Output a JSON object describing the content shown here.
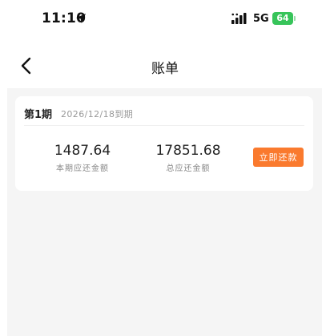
{
  "status_bar": {
    "time": "11:10",
    "network": "5G",
    "battery_level": "64"
  },
  "nav": {
    "title": "账单"
  },
  "bill": {
    "period": "第1期",
    "due_date": "2026/12/18到期",
    "current_amount": "1487.64",
    "current_amount_label": "本期应还金额",
    "total_amount": "17851.68",
    "total_amount_label": "总应还金额",
    "repay_button_label": "立即还款"
  },
  "colors": {
    "accent": "#fa7a2e",
    "battery": "#37c45a",
    "background": "#f5f5f5"
  }
}
